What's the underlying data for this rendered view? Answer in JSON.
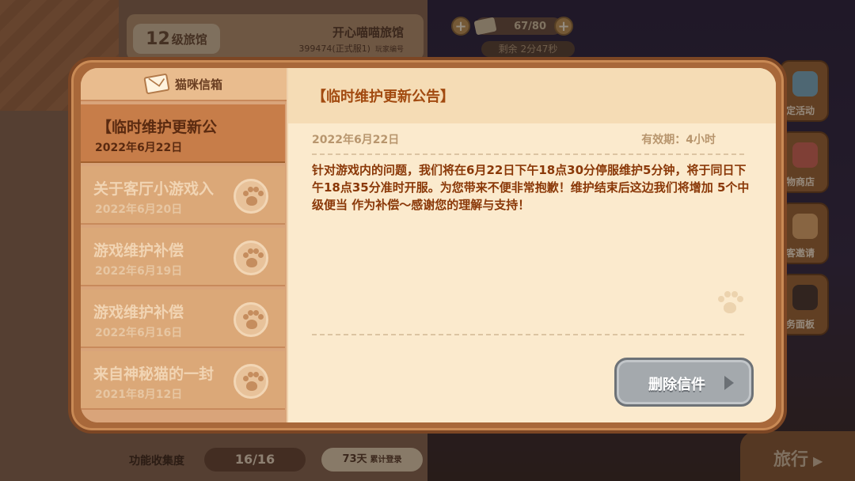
{
  "background": {
    "inn_level_number": "12",
    "inn_level_suffix": "级旅馆",
    "inn_name": "开心喵喵旅馆",
    "player_id": "399474(正式服1)",
    "player_id_label": "玩家编号",
    "resource_count": "67/80",
    "timer_text": "剩余 2分47秒",
    "side_buttons": [
      "定活动",
      "物商店",
      "客邀请",
      "务面板"
    ],
    "footer_label": "功能收集度",
    "footer_progress": "16/16",
    "login_days": "73天",
    "login_label": "累计登录",
    "travel_label": "旅行"
  },
  "mailbox": {
    "title": "猫咪信箱",
    "items": [
      {
        "title": "【临时维护更新公",
        "date": "2022年6月22日",
        "active": true
      },
      {
        "title": "关于客厅小游戏入",
        "date": "2022年6月20日",
        "active": false
      },
      {
        "title": "游戏维护补偿",
        "date": "2022年6月19日",
        "active": false
      },
      {
        "title": "游戏维护补偿",
        "date": "2022年6月16日",
        "active": false
      },
      {
        "title": "来自神秘猫的一封",
        "date": "2021年8月12日",
        "active": false
      }
    ]
  },
  "message": {
    "title": "【临时维护更新公告】",
    "date": "2022年6月22日",
    "validity": "有效期：4小时",
    "body": "针对游戏内的问题，我们将在6月22日下午18点30分停服维护5分钟，将于同日下午18点35分准时开服。为您带来不便非常抱歉！维护结束后这边我们将增加 5个中级便当 作为补偿～感谢您的理解与支持！",
    "delete_label": "删除信件"
  }
}
